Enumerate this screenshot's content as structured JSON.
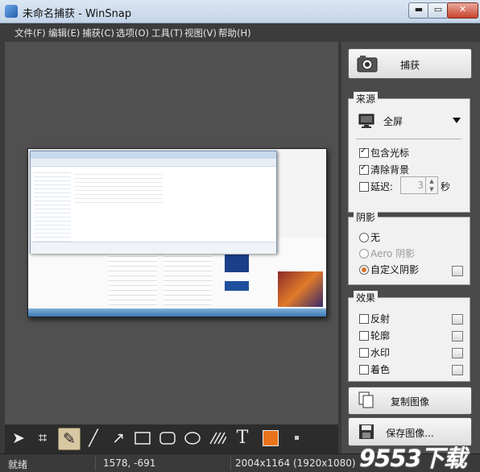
{
  "window": {
    "title": "未命名捕获 - WinSnap",
    "min_glyph": "▬",
    "max_glyph": "▭",
    "close_glyph": "✕"
  },
  "menu": [
    "文件(F)",
    "编辑(E)",
    "捕获(C)",
    "选项(O)",
    "工具(T)",
    "视图(V)",
    "帮助(H)"
  ],
  "capture_button": {
    "label": "捕获"
  },
  "source": {
    "title": "来源",
    "mode": "全屏",
    "include_cursor": {
      "label": "包含光标",
      "checked": true
    },
    "clear_background": {
      "label": "清除背景",
      "checked": true
    },
    "delay": {
      "label": "延迟:",
      "checked": false,
      "value": "3",
      "unit": "秒"
    }
  },
  "shadow": {
    "title": "阴影",
    "options": [
      {
        "label": "无",
        "selected": false
      },
      {
        "label": "Aero 阴影",
        "selected": false,
        "disabled": true
      },
      {
        "label": "自定义阴影",
        "selected": true
      }
    ]
  },
  "effects": {
    "title": "效果",
    "items": [
      {
        "label": "反射",
        "checked": false
      },
      {
        "label": "轮廓",
        "checked": false
      },
      {
        "label": "水印",
        "checked": false
      },
      {
        "label": "着色",
        "checked": false
      }
    ]
  },
  "copy_button": {
    "label": "复制图像"
  },
  "save_button": {
    "label": "保存图像..."
  },
  "toolbar": {
    "tools": [
      "pointer-icon",
      "crop-icon",
      "pen-icon",
      "line-icon",
      "arrow-icon",
      "rectangle-icon",
      "rounded-rect-icon",
      "ellipse-icon",
      "hatch-icon",
      "text-icon"
    ],
    "active_tool": "pen-icon",
    "color": "#e8731c",
    "glyphs": {
      "pointer": "➤",
      "crop": "⌗",
      "pen": "✎",
      "line": "╱",
      "arrow": "↗",
      "text": "T"
    }
  },
  "status": {
    "state": "就绪",
    "coords": "1578, -691",
    "size": "2004x1164 (1920x1080)"
  },
  "watermark": {
    "main": "9553下载",
    "sub": ".com"
  }
}
